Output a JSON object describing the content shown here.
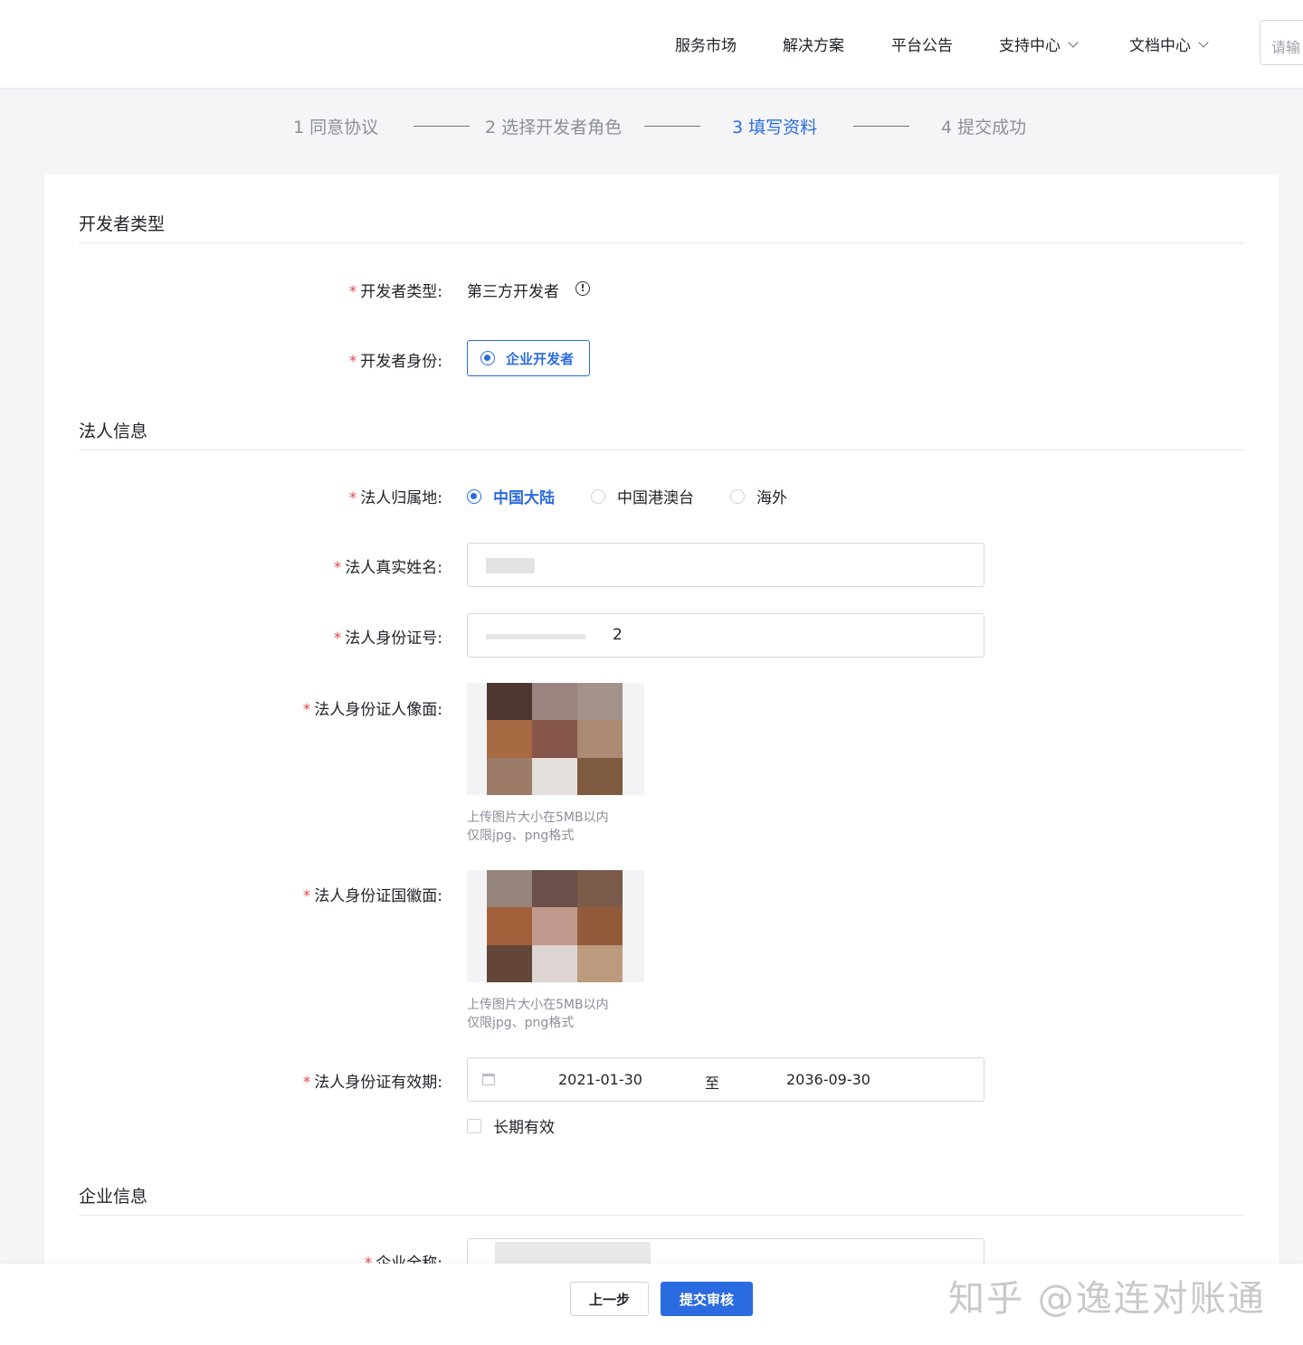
{
  "nav": {
    "items": [
      "服务市场",
      "解决方案",
      "平台公告",
      "支持中心",
      "文档中心"
    ],
    "search_placeholder": "请输"
  },
  "steps": [
    {
      "label": "1 同意协议",
      "state": "done"
    },
    {
      "label": "2 选择开发者角色",
      "state": "done"
    },
    {
      "label": "3 填写资料",
      "state": "active"
    },
    {
      "label": "4 提交成功",
      "state": "pending"
    }
  ],
  "sections": {
    "dev_type": "开发者类型",
    "legal": "法人信息",
    "company": "企业信息"
  },
  "form": {
    "dev_type_label": "开发者类型:",
    "dev_type_value": "第三方开发者",
    "identity_label": "开发者身份:",
    "identity_value": "企业开发者",
    "region_label": "法人归属地:",
    "region_options": [
      "中国大陆",
      "中国港澳台",
      "海外"
    ],
    "region_selected": "中国大陆",
    "name_label": "法人真实姓名:",
    "id_label": "法人身份证号:",
    "id_tail": "2",
    "id_front_label": "法人身份证人像面:",
    "id_back_label": "法人身份证国徽面:",
    "upload_hint_1": "上传图片大小在5MB以内",
    "upload_hint_2": "仅限jpg、png格式",
    "validity_label": "法人身份证有效期:",
    "validity_start": "2021-01-30",
    "validity_sep": "至",
    "validity_end": "2036-09-30",
    "long_term_label": "长期有效",
    "company_name_label": "企业全称:"
  },
  "actions": {
    "prev": "上一步",
    "submit": "提交审核"
  },
  "watermark": "知乎 @逸连对账通",
  "colors": {
    "accent": "#2b6be0",
    "required": "#e5484d"
  }
}
